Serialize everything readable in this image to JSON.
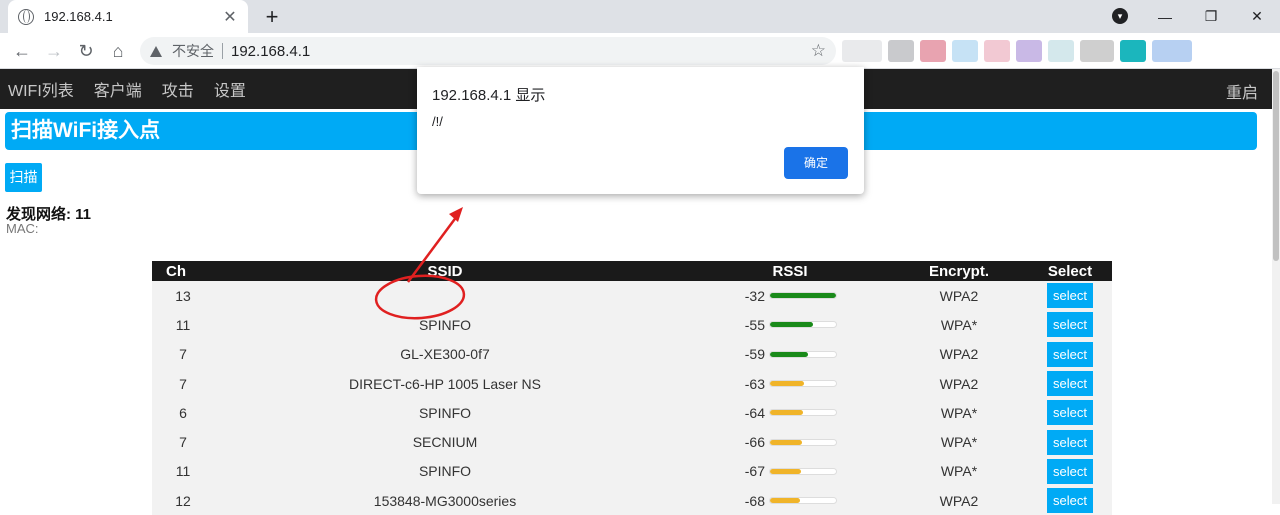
{
  "browser": {
    "tab_title": "192.168.4.1",
    "tab_close": "✕",
    "new_tab": "+",
    "insecure_label": "不安全",
    "url": "192.168.4.1",
    "back": "←",
    "forward": "→",
    "reload": "↻",
    "home": "⌂",
    "star": "☆",
    "win_minimize": "—",
    "win_restore": "❐",
    "win_close": "✕"
  },
  "app_nav": {
    "items": [
      "WIFI列表",
      "客户端",
      "攻击",
      "设置"
    ],
    "reboot": "重启"
  },
  "page": {
    "banner": "扫描WiFi接入点",
    "scan_button": "扫描",
    "found_label": "发现网络: 11",
    "mac_label": "MAC:"
  },
  "table": {
    "headers": [
      "Ch",
      "SSID",
      "RSSI",
      "Encrypt.",
      "Select"
    ],
    "select_label": "select",
    "rows": [
      {
        "ch": "13",
        "ssid": "",
        "rssi": "-32",
        "level": 1.0,
        "enc": "WPA2"
      },
      {
        "ch": "11",
        "ssid": "SPINFO",
        "rssi": "-55",
        "level": 0.65,
        "enc": "WPA*"
      },
      {
        "ch": "7",
        "ssid": "GL-XE300-0f7",
        "rssi": "-59",
        "level": 0.58,
        "enc": "WPA2"
      },
      {
        "ch": "7",
        "ssid": "DIRECT-c6-HP 1005 Laser NS",
        "rssi": "-63",
        "level": 0.52,
        "enc": "WPA2"
      },
      {
        "ch": "6",
        "ssid": "SPINFO",
        "rssi": "-64",
        "level": 0.5,
        "enc": "WPA*"
      },
      {
        "ch": "7",
        "ssid": "SECNIUM",
        "rssi": "-66",
        "level": 0.48,
        "enc": "WPA*"
      },
      {
        "ch": "11",
        "ssid": "SPINFO",
        "rssi": "-67",
        "level": 0.47,
        "enc": "WPA*"
      },
      {
        "ch": "12",
        "ssid": "153848-MG3000series",
        "rssi": "-68",
        "level": 0.45,
        "enc": "WPA2"
      }
    ],
    "colors": {
      "strong": "#1a8a1a",
      "medium": "#f0b429"
    }
  },
  "dialog": {
    "title": "192.168.4.1 显示",
    "message": "/!/",
    "ok": "确定"
  },
  "colors": {
    "accent": "#00aaf5",
    "nav_bg": "#1f1f1f",
    "dialog_button": "#1a73e8",
    "annotation": "#e02020"
  }
}
